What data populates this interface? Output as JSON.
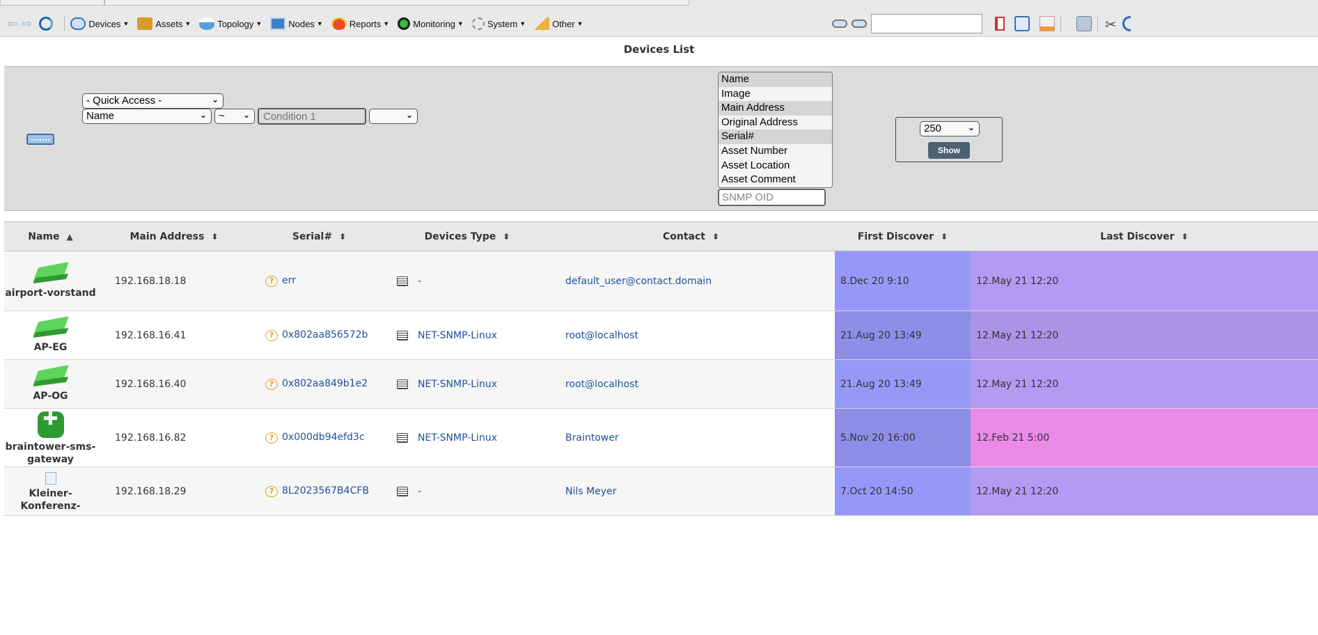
{
  "toolbar": {
    "menus": [
      {
        "label": "Devices",
        "icon": "devices-icon"
      },
      {
        "label": "Assets",
        "icon": "assets-icon"
      },
      {
        "label": "Topology",
        "icon": "topology-icon"
      },
      {
        "label": "Nodes",
        "icon": "nodes-icon"
      },
      {
        "label": "Reports",
        "icon": "reports-icon"
      },
      {
        "label": "Monitoring",
        "icon": "monitoring-icon"
      },
      {
        "label": "System",
        "icon": "gear-icon"
      },
      {
        "label": "Other",
        "icon": "other-icon"
      }
    ],
    "search_value": ""
  },
  "page": {
    "title": "Devices List"
  },
  "filter": {
    "quick_access": "- Quick Access -",
    "field": "Name",
    "operator": "~",
    "condition_placeholder": "Condition 1",
    "extra_select": "",
    "columns": [
      {
        "label": "Name",
        "selected": true
      },
      {
        "label": "Image",
        "selected": false
      },
      {
        "label": "Main Address",
        "selected": true
      },
      {
        "label": "Original Address",
        "selected": false
      },
      {
        "label": "Serial#",
        "selected": true
      },
      {
        "label": "Asset Number",
        "selected": false
      },
      {
        "label": "Asset Location",
        "selected": false
      },
      {
        "label": "Asset Comment",
        "selected": false
      }
    ],
    "oid_placeholder": "SNMP OID",
    "page_size": "250",
    "show_label": "Show"
  },
  "table": {
    "headers": [
      "Name",
      "Main Address",
      "Serial#",
      "Devices Type",
      "Contact",
      "First Discover",
      "Last Discover"
    ],
    "rows": [
      {
        "name": "airport-vorstand",
        "icon": "access-point",
        "address": "192.168.18.18",
        "serial": "err",
        "type": "-",
        "contact": "default_user@contact.domain",
        "first": "8.Dec 20 9:10",
        "last": "12.May 21 12:20",
        "first_color": "#9698f8",
        "last_color": "#b49af2"
      },
      {
        "name": "AP-EG",
        "icon": "access-point",
        "address": "192.168.16.41",
        "serial": "0x802aa856572b",
        "type": "NET-SNMP-Linux",
        "contact": "root@localhost",
        "first": "21.Aug 20 13:49",
        "last": "12.May 21 12:20",
        "first_color": "#8c8ee8",
        "last_color": "#ab94e6"
      },
      {
        "name": "AP-OG",
        "icon": "access-point",
        "address": "192.168.16.40",
        "serial": "0x802aa849b1e2",
        "type": "NET-SNMP-Linux",
        "contact": "root@localhost",
        "first": "21.Aug 20 13:49",
        "last": "12.May 21 12:20",
        "first_color": "#9698f8",
        "last_color": "#b49af2"
      },
      {
        "name": "braintower-sms-gateway",
        "icon": "gateway",
        "address": "192.168.16.82",
        "serial": "0x000db94efd3c",
        "type": "NET-SNMP-Linux",
        "contact": "Braintower",
        "first": "5.Nov 20 16:00",
        "last": "12.Feb 21 5:00",
        "first_color": "#8c8ee8",
        "last_color": "#e88ae6"
      },
      {
        "name": "Kleiner-Konferenz-",
        "icon": "broken",
        "address": "192.168.18.29",
        "serial": "8L2023567B4CFB",
        "type": "-",
        "contact": "Nils Meyer",
        "first": "7.Oct 20 14:50",
        "last": "12.May 21 12:20",
        "first_color": "#9698f8",
        "last_color": "#b49af2"
      }
    ]
  }
}
